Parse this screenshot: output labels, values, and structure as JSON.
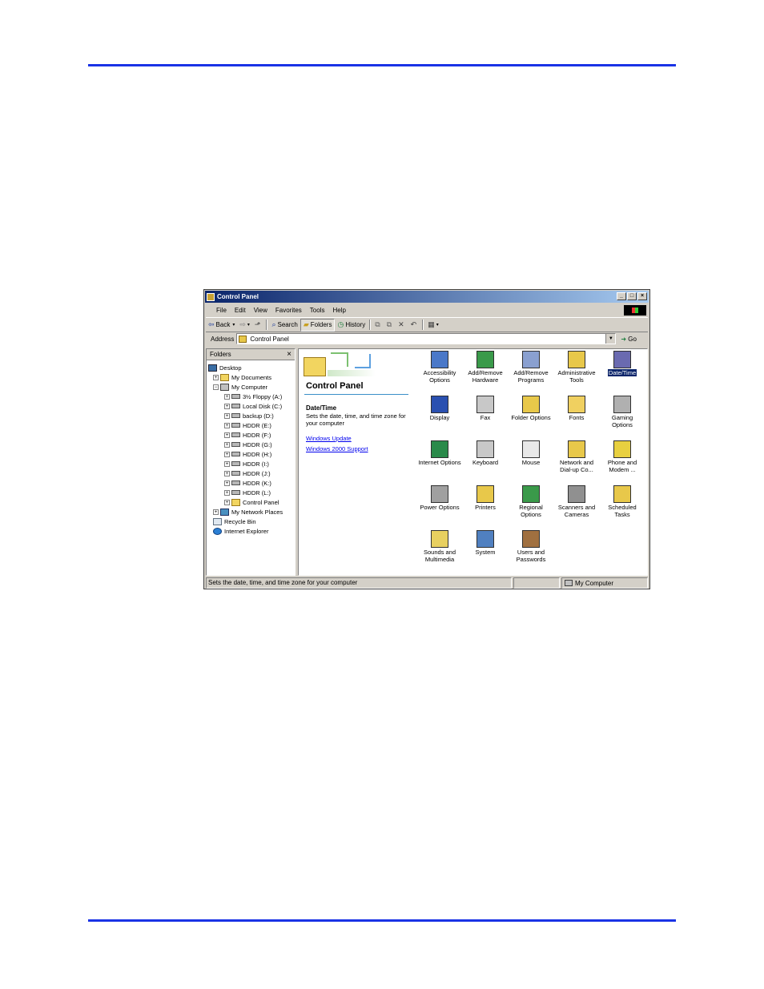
{
  "page": {
    "accent": "#1a33e6"
  },
  "window": {
    "title": "Control Panel",
    "controls": {
      "minimize": "_",
      "maximize": "□",
      "close": "×"
    }
  },
  "menu": [
    "File",
    "Edit",
    "View",
    "Favorites",
    "Tools",
    "Help"
  ],
  "toolbar": {
    "back": "Back",
    "search": "Search",
    "folders": "Folders",
    "history": "History"
  },
  "address": {
    "label": "Address",
    "value": "Control Panel",
    "go": "Go"
  },
  "folders_pane": {
    "title": "Folders",
    "close": "×",
    "tree": [
      {
        "label": "Desktop",
        "icon": "desk"
      },
      {
        "label": "My Documents",
        "icon": "fold"
      },
      {
        "label": "My Computer",
        "icon": "comp"
      },
      {
        "label": "3½ Floppy (A:)",
        "icon": "drv"
      },
      {
        "label": "Local Disk (C:)",
        "icon": "drv"
      },
      {
        "label": "backup (D:)",
        "icon": "drv"
      },
      {
        "label": "HDDR (E:)",
        "icon": "drv"
      },
      {
        "label": "HDDR (F:)",
        "icon": "drv"
      },
      {
        "label": "HDDR (G:)",
        "icon": "drv"
      },
      {
        "label": "HDDR (H:)",
        "icon": "drv"
      },
      {
        "label": "HDDR (I:)",
        "icon": "drv"
      },
      {
        "label": "HDDR (J:)",
        "icon": "drv"
      },
      {
        "label": "HDDR (K:)",
        "icon": "drv"
      },
      {
        "label": "HDDR (L:)",
        "icon": "drv"
      },
      {
        "label": "Control Panel",
        "icon": "fold"
      },
      {
        "label": "My Network Places",
        "icon": "net"
      },
      {
        "label": "Recycle Bin",
        "icon": "bin"
      },
      {
        "label": "Internet Explorer",
        "icon": "ie"
      }
    ]
  },
  "content": {
    "heading": "Control Panel",
    "selected_title": "Date/Time",
    "selected_desc": "Sets the date, time, and time zone for your computer",
    "link_update": "Windows Update",
    "link_support": "Windows 2000 Support",
    "items": [
      {
        "label": "Accessibility Options",
        "color": "#4a78c8"
      },
      {
        "label": "Add/Remove Hardware",
        "color": "#3a9a4a"
      },
      {
        "label": "Add/Remove Programs",
        "color": "#8aa0d0"
      },
      {
        "label": "Administrative Tools",
        "color": "#e8c84a"
      },
      {
        "label": "Date/Time",
        "color": "#6a6ab0"
      },
      {
        "label": "Display",
        "color": "#2a50b0"
      },
      {
        "label": "Fax",
        "color": "#c8c8c8"
      },
      {
        "label": "Folder Options",
        "color": "#e8c84a"
      },
      {
        "label": "Fonts",
        "color": "#f0d060"
      },
      {
        "label": "Gaming Options",
        "color": "#b0b0b0"
      },
      {
        "label": "Internet Options",
        "color": "#2a8a4a"
      },
      {
        "label": "Keyboard",
        "color": "#c8c8c8"
      },
      {
        "label": "Mouse",
        "color": "#e8e8e8"
      },
      {
        "label": "Network and Dial-up Co...",
        "color": "#e8c84a"
      },
      {
        "label": "Phone and Modem ...",
        "color": "#e8d040"
      },
      {
        "label": "Power Options",
        "color": "#a0a0a0"
      },
      {
        "label": "Printers",
        "color": "#e8c84a"
      },
      {
        "label": "Regional Options",
        "color": "#3a9a4a"
      },
      {
        "label": "Scanners and Cameras",
        "color": "#909090"
      },
      {
        "label": "Scheduled Tasks",
        "color": "#e8c84a"
      },
      {
        "label": "Sounds and Multimedia",
        "color": "#e8d060"
      },
      {
        "label": "System",
        "color": "#5080c0"
      },
      {
        "label": "Users and Passwords",
        "color": "#a07040"
      }
    ],
    "selected_index": 4
  },
  "status": {
    "text": "Sets the date, time, and time zone for your computer",
    "zone": "My Computer"
  }
}
